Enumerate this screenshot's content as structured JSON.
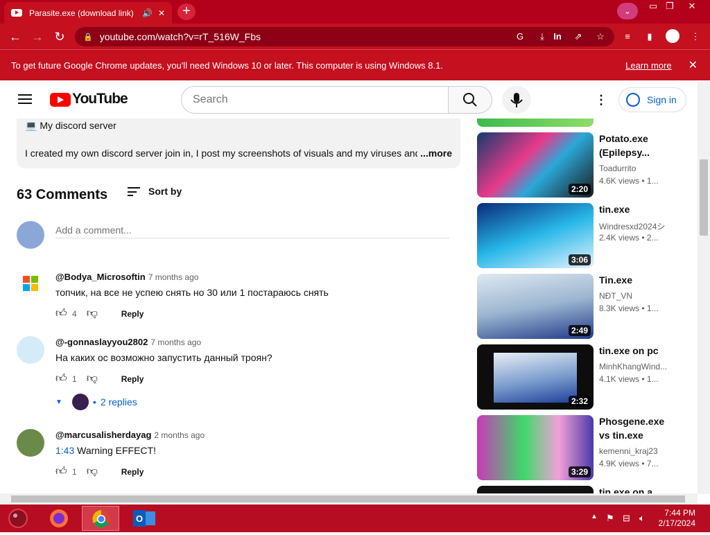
{
  "browser": {
    "tab_title": "Parasite.exe (download link)",
    "url": "youtube.com/watch?v=rT_516W_Fbs",
    "infobar_message": "To get future Google Chrome updates, you'll need Windows 10 or later. This computer is using Windows 8.1.",
    "infobar_link": "Learn more",
    "ext_label": "In"
  },
  "youtube": {
    "logo_text": "YouTube",
    "search_placeholder": "Search",
    "signin_label": "Sign in"
  },
  "description": {
    "line1": "My discord server",
    "line2": "I created my own discord server join in, I post my screenshots of visuals and my viruses and",
    "more": "...more"
  },
  "comments_section": {
    "count_label": "63 Comments",
    "sort_label": "Sort by",
    "add_placeholder": "Add a comment..."
  },
  "comments": [
    {
      "author": "@Bodya_Microsoftin",
      "time": "7 months ago",
      "text": "топчик, на все не успею снять но 30 или 1 постараюсь снять",
      "likes": "4",
      "reply": "Reply"
    },
    {
      "author": "@-gonnaslayyou2802",
      "time": "7 months ago",
      "text": "На каких ос возможно запустить данный троян?",
      "likes": "1",
      "reply": "Reply",
      "replies_label": "2 replies"
    },
    {
      "author": "@marcusalisherdayag",
      "time": "2 months ago",
      "timestamp": "1:43",
      "text": " Warning EFFECT!",
      "likes": "1",
      "reply": "Reply"
    }
  ],
  "sidebar": [
    {
      "title": "Potato.exe (Epilepsy...",
      "channel": "Toadurrito",
      "views": "4.6K views",
      "age": "1...",
      "duration": "2:20"
    },
    {
      "title": "tin.exe",
      "channel": "Windresxd2024シ",
      "views": "2.4K views",
      "age": "2...",
      "duration": "3:06"
    },
    {
      "title": "Tin.exe",
      "channel": "NĐT_VN",
      "views": "8.3K views",
      "age": "1...",
      "duration": "2:49"
    },
    {
      "title": "tin.exe on pc",
      "channel": "MinhKhangWind...",
      "views": "4.1K views",
      "age": "1...",
      "duration": "2:32"
    },
    {
      "title": "Phosgene.exe vs tin.exe",
      "channel": "kemenni_kraj23",
      "views": "4.9K views",
      "age": "7...",
      "duration": "3:29"
    },
    {
      "title": "tin.exe on a",
      "channel": "",
      "views": "",
      "age": "",
      "duration": ""
    }
  ],
  "taskbar": {
    "time": "7:44 PM",
    "date": "2/17/2024"
  }
}
